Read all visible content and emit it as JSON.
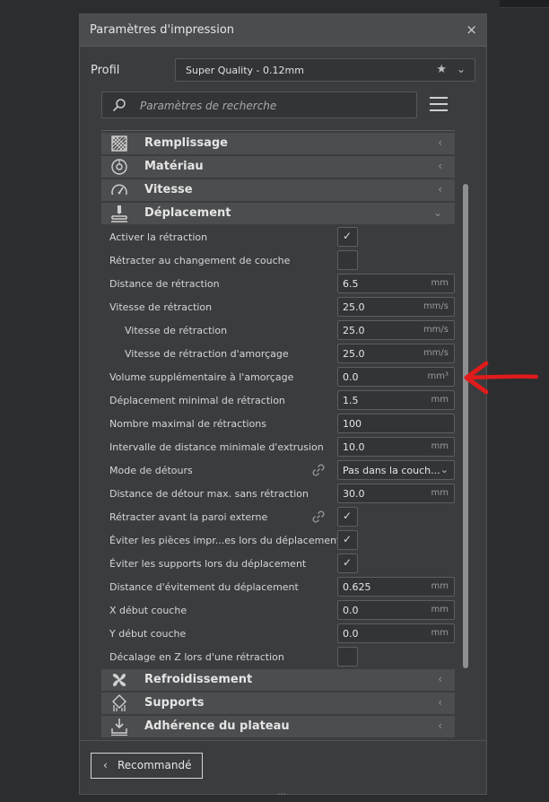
{
  "window": {
    "title": "Paramètres d'impression",
    "close_glyph": "×"
  },
  "profile": {
    "label": "Profil",
    "value": "Super Quality - 0.12mm",
    "star_icon": "star-icon",
    "chevron": "⌄"
  },
  "search": {
    "placeholder": "Paramètres de recherche",
    "icon": "search-icon"
  },
  "categories_top": [
    {
      "label": "Remplissage",
      "icon": "infill-icon",
      "chevron": "‹"
    },
    {
      "label": "Matériau",
      "icon": "material-icon",
      "chevron": "‹"
    },
    {
      "label": "Vitesse",
      "icon": "speed-icon",
      "chevron": "‹"
    },
    {
      "label": "Déplacement",
      "icon": "travel-icon",
      "chevron": "⌄"
    }
  ],
  "settings": [
    {
      "label": "Activer la rétraction",
      "checked": true
    },
    {
      "label": "Rétracter au changement de couche",
      "checked": false
    },
    {
      "label": "Distance de rétraction",
      "value": "6.5",
      "unit": "mm"
    },
    {
      "label": "Vitesse de rétraction",
      "value": "25.0",
      "unit": "mm/s"
    },
    {
      "label": "Vitesse de rétraction",
      "value": "25.0",
      "unit": "mm/s"
    },
    {
      "label": "Vitesse de rétraction d'amorçage",
      "value": "25.0",
      "unit": "mm/s"
    },
    {
      "label": "Volume supplémentaire à l'amorçage",
      "value": "0.0",
      "unit": "mm³"
    },
    {
      "label": "Déplacement minimal de rétraction",
      "value": "1.5",
      "unit": "mm"
    },
    {
      "label": "Nombre maximal de rétractions",
      "value": "100",
      "unit": ""
    },
    {
      "label": "Intervalle de distance minimale d'extrusion",
      "value": "10.0",
      "unit": "mm"
    },
    {
      "label": "Mode de détours",
      "value": "Pas dans la couch...",
      "dropdown": "⌄"
    },
    {
      "label": "Distance de détour max. sans rétraction",
      "value": "30.0",
      "unit": "mm"
    },
    {
      "label": "Rétracter avant la paroi externe",
      "checked": true
    },
    {
      "label": "Éviter les pièces impr...es lors du déplacement",
      "checked": true
    },
    {
      "label": "Éviter les supports lors du déplacement",
      "checked": true
    },
    {
      "label": "Distance d'évitement du déplacement",
      "value": "0.625",
      "unit": "mm"
    },
    {
      "label": "X début couche",
      "value": "0.0",
      "unit": "mm"
    },
    {
      "label": "Y début couche",
      "value": "0.0",
      "unit": "mm"
    },
    {
      "label": "Décalage en Z lors d'une rétraction",
      "checked": false
    }
  ],
  "categories_bottom": [
    {
      "label": "Refroidissement",
      "icon": "cooling-icon",
      "chevron": "‹"
    },
    {
      "label": "Supports",
      "icon": "support-icon",
      "chevron": "‹"
    },
    {
      "label": "Adhérence du plateau",
      "icon": "adhesion-icon",
      "chevron": "‹"
    }
  ],
  "check_glyph": "✓",
  "footer": {
    "button_label": "Recommandé",
    "button_chevron": "‹",
    "grip": "⋯"
  },
  "colors": {
    "annotation_arrow": "#e01b1b",
    "panel_bg": "#3a3c3e",
    "category_bg": "#4b4d4f"
  }
}
